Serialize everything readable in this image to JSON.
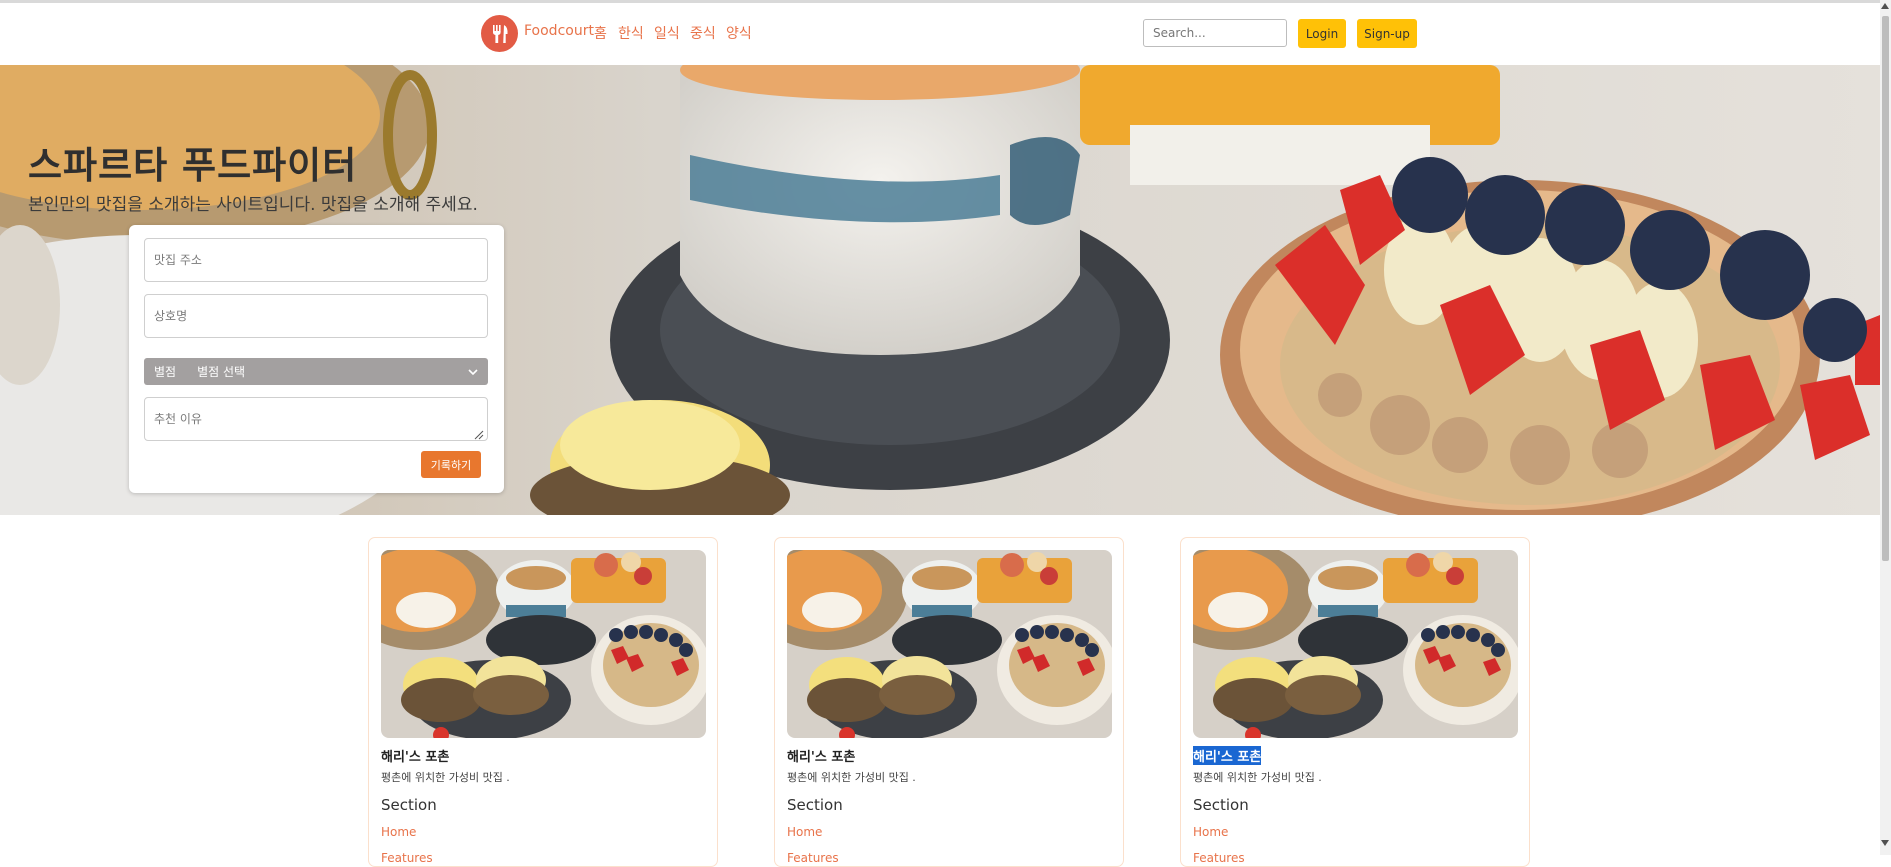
{
  "navbar": {
    "brand": "Foodcourt",
    "links": [
      "홈",
      "한식",
      "일식",
      "중식",
      "양식"
    ],
    "search_placeholder": "Search...",
    "login_label": "Login",
    "signup_label": "Sign-up"
  },
  "hero": {
    "title": "스파르타 푸드파이터",
    "subtitle": "본인만의 맛집을 소개하는 사이트입니다. 맛집을 소개해 주세요."
  },
  "form": {
    "address_placeholder": "맛집 주소",
    "name_placeholder": "상호명",
    "rating_label": "별점",
    "rating_value": "별점 선택",
    "reason_placeholder": "추천 이유",
    "submit_label": "기록하기"
  },
  "cards": [
    {
      "title": "해리'스 포촌",
      "text": "평촌에 위치한 가성비 맛집 .",
      "section": "Section",
      "links": [
        "Home",
        "Features"
      ]
    },
    {
      "title": "해리'스 포촌",
      "text": "평촌에 위치한 가성비 맛집 .",
      "section": "Section",
      "links": [
        "Home",
        "Features"
      ]
    },
    {
      "title": "해리'스 포촌",
      "text": "평촌에 위치한 가성비 맛집 .",
      "section": "Section",
      "links": [
        "Home",
        "Features"
      ]
    }
  ],
  "colors": {
    "accent": "#e8734a",
    "button_yellow": "#ffc107",
    "submit_orange": "#e8772e",
    "selection_blue": "#1a67d2"
  },
  "icons": [
    "fork-knife-icon",
    "chevron-down-icon",
    "resize-grip-icon"
  ]
}
